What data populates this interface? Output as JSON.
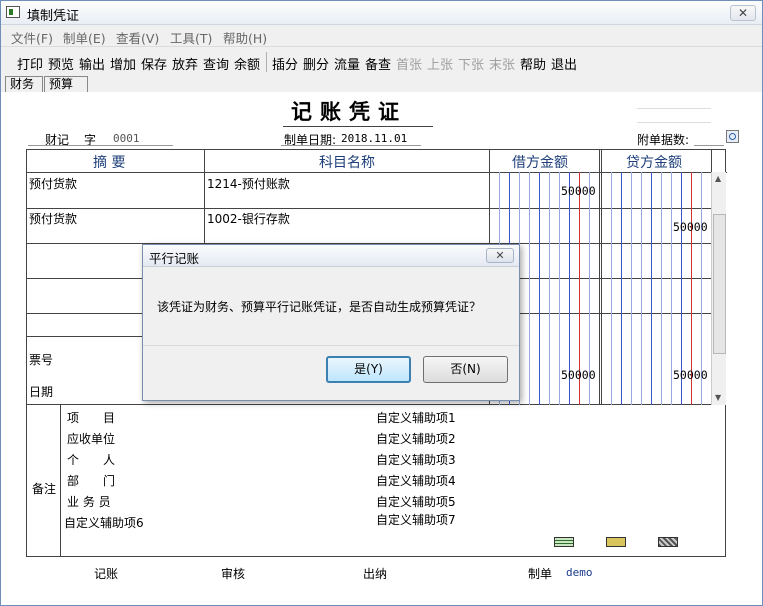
{
  "window": {
    "title": "填制凭证",
    "close": "✕"
  },
  "menu": [
    "文件(F)",
    "制单(E)",
    "查看(V)",
    "工具(T)",
    "帮助(H)"
  ],
  "toolbar": {
    "group1": [
      "打印",
      "预览",
      "输出",
      "增加",
      "保存",
      "放弃",
      "查询",
      "余额"
    ],
    "group2": [
      "插分",
      "删分",
      "流量",
      "备查"
    ],
    "group2_disabled": [
      "首张",
      "上张",
      "下张",
      "末张"
    ],
    "group3": [
      "帮助",
      "退出"
    ]
  },
  "tabs": [
    "财务",
    "预算"
  ],
  "voucher": {
    "title": "记账凭证",
    "type_label": "财记",
    "number_label": "字",
    "number": "0001",
    "date_label": "制单日期:",
    "date": "2018.11.01",
    "attachments_label": "附单据数:",
    "columns": {
      "summary": "摘 要",
      "account": "科目名称",
      "debit": "借方金额",
      "credit": "贷方金额"
    },
    "rows": [
      {
        "summary": "预付货款",
        "account": "1214-预付账款",
        "debit": "50000",
        "credit": ""
      },
      {
        "summary": "预付货款",
        "account": "1002-银行存款",
        "debit": "",
        "credit": "50000"
      }
    ],
    "bill_no_label": "票号",
    "date_row_label": "日期",
    "total_debit": "50000",
    "total_credit": "50000"
  },
  "notes": {
    "label": "备注",
    "left": [
      "项　　目",
      "应收单位",
      "个　　人",
      "部　　门",
      "业 务 员",
      "自定义辅助项6"
    ],
    "right": [
      "自定义辅助项1",
      "自定义辅助项2",
      "自定义辅助项3",
      "自定义辅助项4",
      "自定义辅助项5",
      "自定义辅助项7"
    ]
  },
  "footer": {
    "bookkeeper": "记账",
    "reviewer": "审核",
    "cashier": "出纳",
    "maker_label": "制单",
    "maker": "demo"
  },
  "dialog": {
    "title": "平行记账",
    "message": "该凭证为财务、预算平行记账凭证，是否自动生成预算凭证？",
    "yes": "是(Y)",
    "no": "否(N)",
    "close": "✕"
  }
}
